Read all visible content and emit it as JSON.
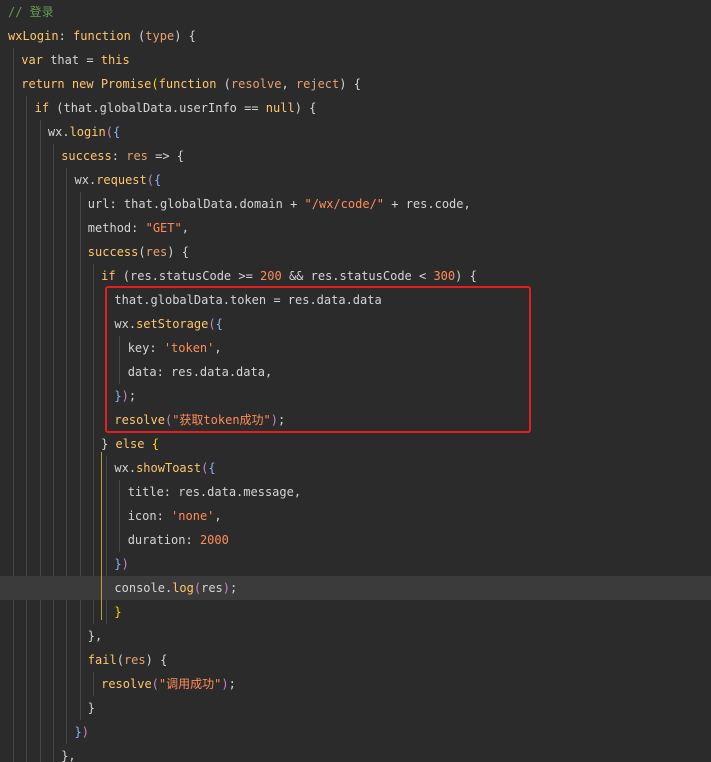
{
  "lines": [
    [
      {
        "t": "// 登录",
        "c": "cm"
      }
    ],
    [
      {
        "t": "wxLogin",
        "c": "fn"
      },
      {
        "t": ": ",
        "c": "pr"
      },
      {
        "t": "function",
        "c": "kw"
      },
      {
        "t": " (",
        "c": "pr"
      },
      {
        "t": "type",
        "c": "ar"
      },
      {
        "t": ") {",
        "c": "pr"
      }
    ],
    [
      {
        "t": "var",
        "c": "kw"
      },
      {
        "t": " that = ",
        "c": "pr"
      },
      {
        "t": "this",
        "c": "kw"
      }
    ],
    [
      {
        "t": "return",
        "c": "kw"
      },
      {
        "t": " ",
        "c": "pr"
      },
      {
        "t": "new",
        "c": "kw"
      },
      {
        "t": " ",
        "c": "pr"
      },
      {
        "t": "Promise",
        "c": "fn"
      },
      {
        "t": "(",
        "c": "bkg"
      },
      {
        "t": "function",
        "c": "kw"
      },
      {
        "t": " (",
        "c": "pr"
      },
      {
        "t": "resolve",
        "c": "ar"
      },
      {
        "t": ", ",
        "c": "pr"
      },
      {
        "t": "reject",
        "c": "ar"
      },
      {
        "t": ") {",
        "c": "pr"
      }
    ],
    [
      {
        "t": "if",
        "c": "kw"
      },
      {
        "t": " (that.globalData.userInfo == ",
        "c": "pr"
      },
      {
        "t": "null",
        "c": "kw"
      },
      {
        "t": ") {",
        "c": "pr"
      }
    ],
    [
      {
        "t": "wx.",
        "c": "pr"
      },
      {
        "t": "login",
        "c": "fn"
      },
      {
        "t": "(",
        "c": "bkm"
      },
      {
        "t": "{",
        "c": "bkb"
      }
    ],
    [
      {
        "t": "success",
        "c": "fn"
      },
      {
        "t": ": ",
        "c": "pr"
      },
      {
        "t": "res",
        "c": "ar"
      },
      {
        "t": " => {",
        "c": "pr"
      }
    ],
    [
      {
        "t": "wx.",
        "c": "pr"
      },
      {
        "t": "request",
        "c": "fn"
      },
      {
        "t": "(",
        "c": "bkm"
      },
      {
        "t": "{",
        "c": "bkb"
      }
    ],
    [
      {
        "t": "url: that.globalData.domain + ",
        "c": "pr"
      },
      {
        "t": "\"/wx/code/\"",
        "c": "st"
      },
      {
        "t": " + res.code,",
        "c": "pr"
      }
    ],
    [
      {
        "t": "method: ",
        "c": "pr"
      },
      {
        "t": "\"GET\"",
        "c": "st"
      },
      {
        "t": ",",
        "c": "pr"
      }
    ],
    [
      {
        "t": "success",
        "c": "fn"
      },
      {
        "t": "(",
        "c": "pr"
      },
      {
        "t": "res",
        "c": "ar"
      },
      {
        "t": ") {",
        "c": "pr"
      }
    ],
    [
      {
        "t": "if",
        "c": "kw"
      },
      {
        "t": " (res.statusCode >= ",
        "c": "pr"
      },
      {
        "t": "200",
        "c": "nm"
      },
      {
        "t": " && res.statusCode < ",
        "c": "pr"
      },
      {
        "t": "300",
        "c": "nm"
      },
      {
        "t": ") {",
        "c": "pr"
      }
    ],
    [
      {
        "t": "that.globalData.token = res.data.data",
        "c": "pr"
      }
    ],
    [
      {
        "t": "wx.",
        "c": "pr"
      },
      {
        "t": "setStorage",
        "c": "fn"
      },
      {
        "t": "(",
        "c": "bkm"
      },
      {
        "t": "{",
        "c": "bkb"
      }
    ],
    [
      {
        "t": "key: ",
        "c": "pr"
      },
      {
        "t": "'token'",
        "c": "st"
      },
      {
        "t": ",",
        "c": "pr"
      }
    ],
    [
      {
        "t": "data: res.data.data,",
        "c": "pr"
      }
    ],
    [
      {
        "t": "}",
        "c": "bkb"
      },
      {
        "t": ")",
        "c": "bkm"
      },
      {
        "t": ";",
        "c": "pr"
      }
    ],
    [
      {
        "t": "resolve",
        "c": "fn"
      },
      {
        "t": "(",
        "c": "bkm"
      },
      {
        "t": "\"获取token成功\"",
        "c": "st"
      },
      {
        "t": ")",
        "c": "bkm"
      },
      {
        "t": ";",
        "c": "pr"
      }
    ],
    [
      {
        "t": "} ",
        "c": "pr"
      },
      {
        "t": "else",
        "c": "kw"
      },
      {
        "t": " ",
        "c": "pr"
      },
      {
        "t": "{",
        "c": "bkg"
      }
    ],
    [
      {
        "t": "wx.",
        "c": "pr"
      },
      {
        "t": "showToast",
        "c": "fn"
      },
      {
        "t": "(",
        "c": "bkm"
      },
      {
        "t": "{",
        "c": "bkb"
      }
    ],
    [
      {
        "t": "title: res.data.message,",
        "c": "pr"
      }
    ],
    [
      {
        "t": "icon: ",
        "c": "pr"
      },
      {
        "t": "'none'",
        "c": "st"
      },
      {
        "t": ",",
        "c": "pr"
      }
    ],
    [
      {
        "t": "duration: ",
        "c": "pr"
      },
      {
        "t": "2000",
        "c": "nm"
      }
    ],
    [
      {
        "t": "}",
        "c": "bkb"
      },
      {
        "t": ")",
        "c": "bkm"
      }
    ],
    [
      {
        "t": "console.",
        "c": "pr"
      },
      {
        "t": "log",
        "c": "fn"
      },
      {
        "t": "(",
        "c": "bkm"
      },
      {
        "t": "res",
        "c": "pr"
      },
      {
        "t": ")",
        "c": "bkm"
      },
      {
        "t": ";",
        "c": "pr"
      }
    ],
    [
      {
        "t": "}",
        "c": "bkg"
      }
    ],
    [
      {
        "t": "},",
        "c": "pr"
      }
    ],
    [
      {
        "t": "fail",
        "c": "fn"
      },
      {
        "t": "(",
        "c": "pr"
      },
      {
        "t": "res",
        "c": "ar"
      },
      {
        "t": ") {",
        "c": "pr"
      }
    ],
    [
      {
        "t": "resolve",
        "c": "fn"
      },
      {
        "t": "(",
        "c": "bkm"
      },
      {
        "t": "\"调用成功\"",
        "c": "st"
      },
      {
        "t": ")",
        "c": "bkm"
      },
      {
        "t": ";",
        "c": "pr"
      }
    ],
    [
      {
        "t": "}",
        "c": "pr"
      }
    ],
    [
      {
        "t": "}",
        "c": "bkb"
      },
      {
        "t": ")",
        "c": "bkm"
      }
    ],
    [
      {
        "t": "},",
        "c": "pr"
      }
    ]
  ],
  "highlighted_line_index": 24
}
